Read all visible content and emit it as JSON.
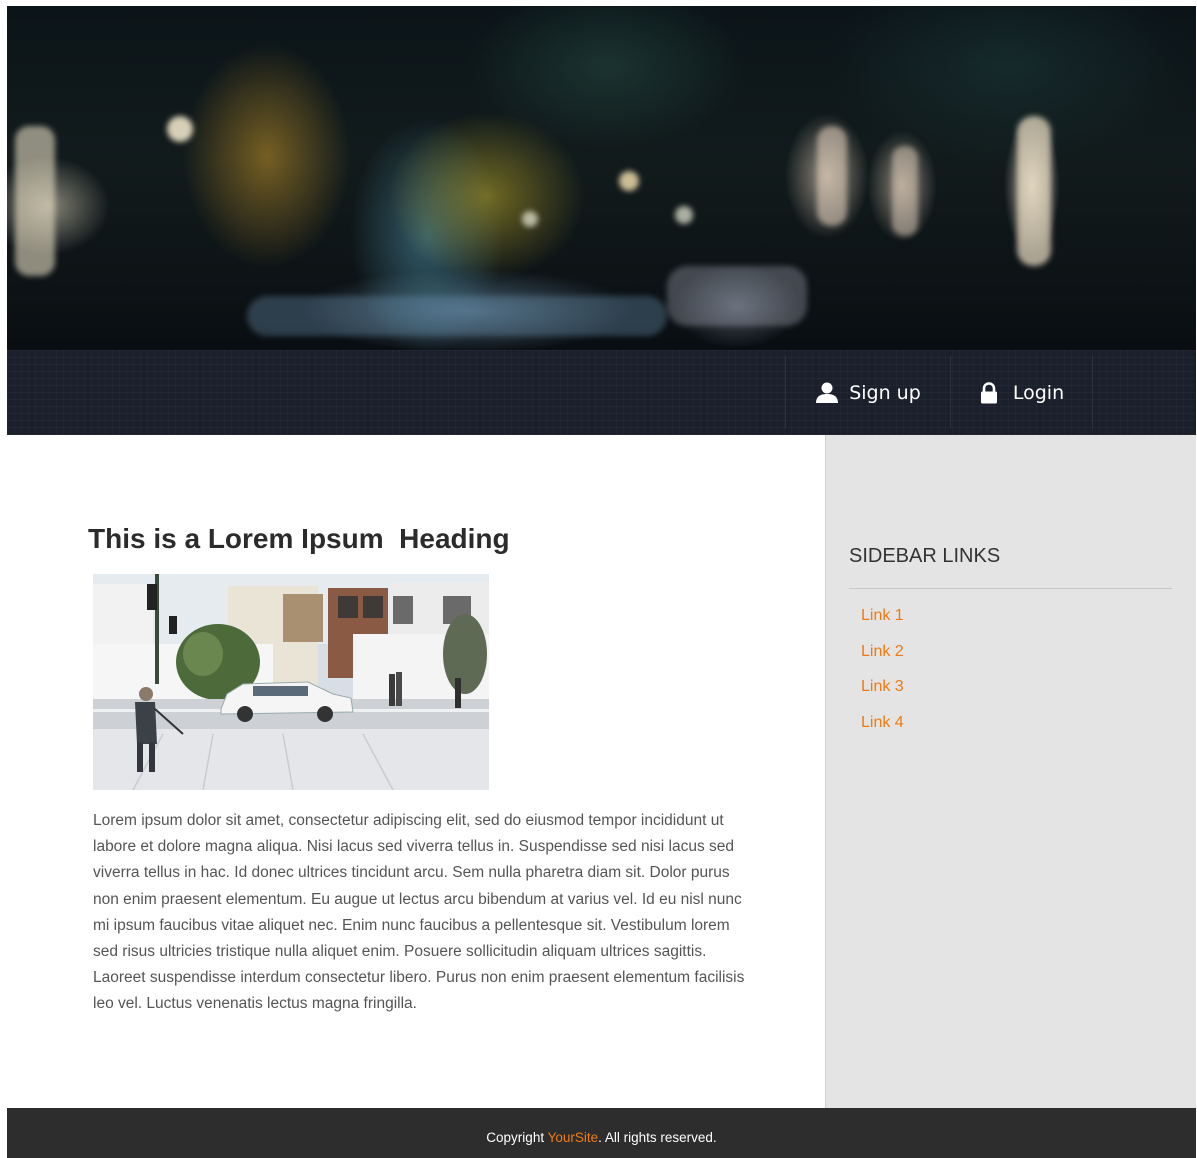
{
  "nav": {
    "items": [
      {
        "label": "Sign up",
        "icon": "user-icon"
      },
      {
        "label": "Login",
        "icon": "lock-icon"
      }
    ]
  },
  "main": {
    "heading": "This is a Lorem Ipsum  Heading",
    "body": "Lorem ipsum dolor sit amet, consectetur adipiscing elit, sed do eiusmod tempor incididunt ut labore et dolore magna aliqua. Nisi lacus sed viverra tellus in. Suspendisse sed nisi lacus sed viverra tellus in hac. Id donec ultrices tincidunt arcu. Sem nulla pharetra diam sit. Dolor purus non enim praesent elementum. Eu augue ut lectus arcu bibendum at varius vel. Id eu nisl nunc mi ipsum faucibus vitae aliquet nec. Enim nunc faucibus a pellentesque sit. Vestibulum lorem sed risus ultricies tristique nulla aliquet enim. Posuere sollicitudin aliquam ultrices sagittis. Laoreet suspendisse interdum consectetur libero. Purus non enim praesent elementum facilisis leo vel. Luctus venenatis lectus magna fringilla."
  },
  "sidebar": {
    "title": "SIDEBAR LINKS",
    "links": [
      "Link 1",
      "Link 2",
      "Link 3",
      "Link 4"
    ]
  },
  "footer": {
    "prefix": "Copyright ",
    "brand": "YourSite",
    "suffix": ". All rights reserved."
  },
  "colors": {
    "accent": "#f07a12",
    "navbar": "#1b1f2b",
    "footer": "#2d2d2d",
    "sidebar": "#e4e4e4"
  }
}
